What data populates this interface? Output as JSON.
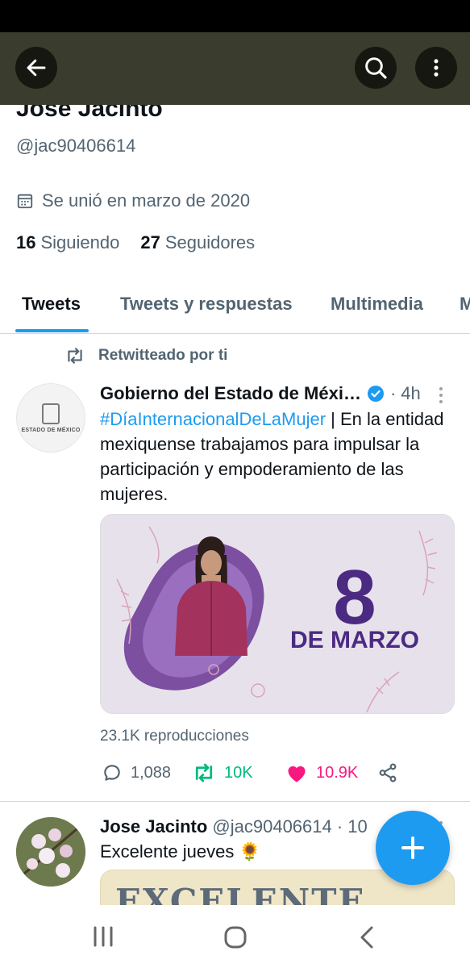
{
  "header": {
    "back_icon": "arrow-left-icon",
    "search_icon": "search-icon",
    "menu_icon": "more-vertical-icon"
  },
  "profile": {
    "name": "Jose Jacinto",
    "handle": "@jac90406614",
    "joined_icon": "calendar-icon",
    "joined": "Se unió en marzo de 2020",
    "following_count": "16",
    "following_label": "Siguiendo",
    "followers_count": "27",
    "followers_label": "Seguidores"
  },
  "tabs": [
    {
      "label": "Tweets",
      "active": true
    },
    {
      "label": "Tweets y respuestas",
      "active": false
    },
    {
      "label": "Multimedia",
      "active": false
    },
    {
      "label": "M",
      "active": false
    }
  ],
  "tweets": [
    {
      "retweet_label": "Retwitteado por ti",
      "avatar_text": "ESTADO DE MÉXICO",
      "author": "Gobierno del Estado de Méxi…",
      "time": "4h",
      "hashtag": "#DíaInternacionalDeLaMujer",
      "text": " | En la entidad mexiquense trabajamos para impulsar la participación y empoderamiento de las mujeres.",
      "media": {
        "big": "8",
        "line": "DE MARZO"
      },
      "views": "23.1K reproducciones",
      "replies": "1,088",
      "retweets": "10K",
      "likes": "10.9K",
      "colors": {
        "retweet": "#00ba7c",
        "like": "#f91880",
        "accent": "#1d9bf0"
      }
    },
    {
      "author": "Jose Jacinto",
      "handle_time": "@jac90406614 · 10",
      "text": "Excelente jueves 🌻",
      "media_text": "EXCELENTE"
    }
  ],
  "fab": {
    "icon": "plus-icon"
  },
  "navbar": {
    "recents_icon": "recents-icon",
    "home_icon": "home-icon",
    "back_icon": "back-chevron-icon"
  }
}
